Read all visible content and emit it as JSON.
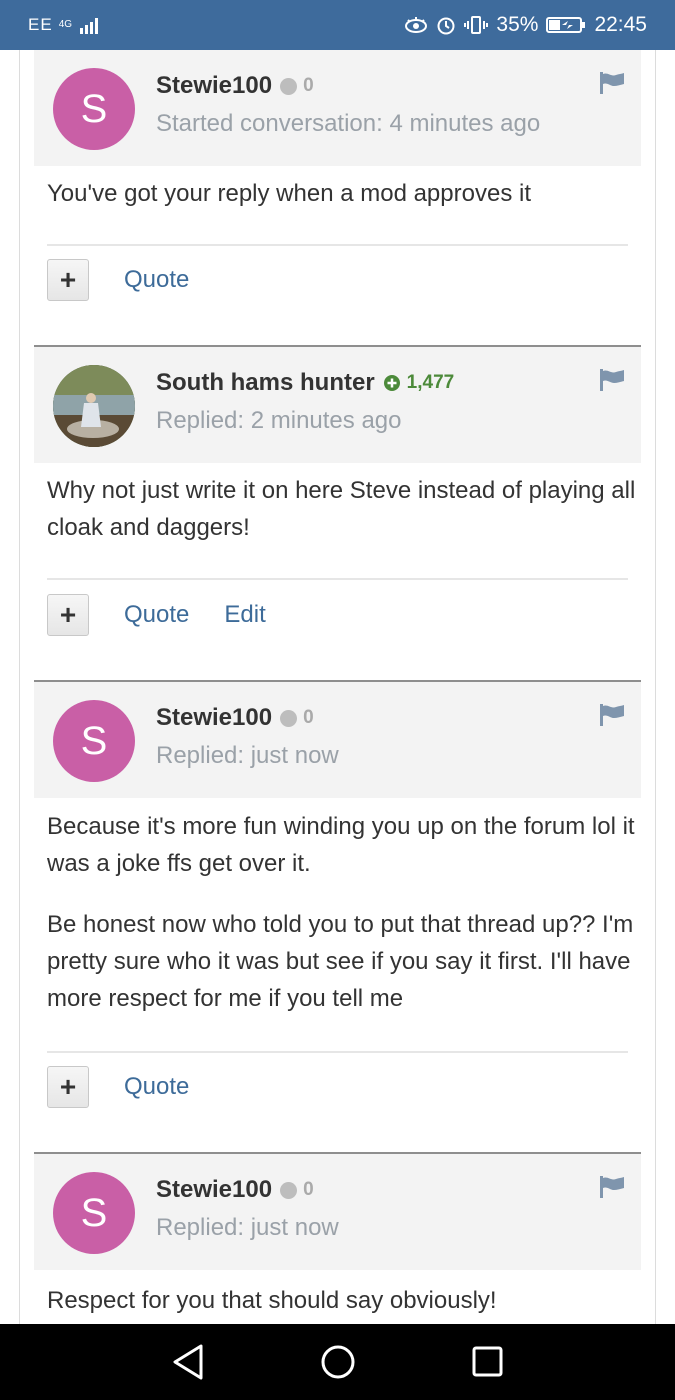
{
  "status_bar": {
    "carrier": "EE",
    "network": "4G",
    "battery": "35%",
    "time": "22:45",
    "colors": {
      "background": "#3e6b9c"
    }
  },
  "posts": [
    {
      "author": "Stewie100",
      "avatar_letter": "S",
      "reputation": "0",
      "reputation_type": "neutral",
      "meta": "Started conversation: 4 minutes ago",
      "paragraphs": [
        "You've got your reply when a mod approves it"
      ],
      "actions": [
        "Quote"
      ]
    },
    {
      "author": "South hams hunter",
      "avatar_letter": "",
      "reputation": "1,477",
      "reputation_type": "positive",
      "meta": "Replied: 2 minutes ago",
      "paragraphs": [
        "Why not just write it on here Steve instead of playing all cloak and daggers!"
      ],
      "actions": [
        "Quote",
        "Edit"
      ]
    },
    {
      "author": "Stewie100",
      "avatar_letter": "S",
      "reputation": "0",
      "reputation_type": "neutral",
      "meta": "Replied: just now",
      "paragraphs": [
        "Because it's more fun winding you up on the forum lol it was a joke ffs get over it.",
        "Be honest now who told you to put that thread up?? I'm pretty sure who it was but see if you say it first. I'll have more respect for me if you tell me"
      ],
      "actions": [
        "Quote"
      ]
    },
    {
      "author": "Stewie100",
      "avatar_letter": "S",
      "reputation": "0",
      "reputation_type": "neutral",
      "meta": "Replied: just now",
      "paragraphs": [
        "Respect for you that should say obviously!"
      ],
      "actions": []
    }
  ],
  "colors": {
    "avatar": "#c95fa6",
    "link": "#3d6b99",
    "positive_rep": "#4c8a3a",
    "header_bg": "#f3f3f3"
  }
}
